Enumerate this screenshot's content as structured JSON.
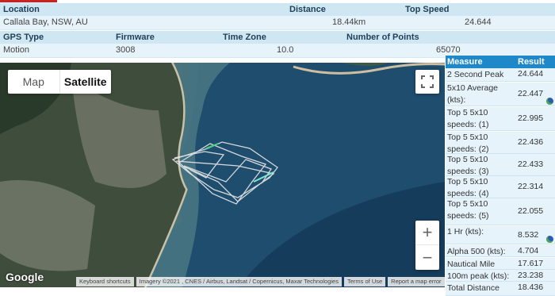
{
  "session": {
    "headers1": {
      "location": "Location",
      "distance": "Distance",
      "top_speed": "Top Speed"
    },
    "values1": {
      "location": "Callala Bay, NSW, AU",
      "distance": "18.44km",
      "top_speed": "24.644"
    },
    "headers2": {
      "gps_type": "GPS Type",
      "firmware": "Firmware",
      "time_zone": "Time Zone",
      "points": "Number of Points"
    },
    "values2": {
      "gps_type": "Motion",
      "firmware": "3008",
      "time_zone": "10.0",
      "points": "65070"
    }
  },
  "map": {
    "map_label": "Map",
    "satellite_label": "Satellite",
    "fullscreen_icon": "fullscreen-icon",
    "zoom_in": "+",
    "zoom_out": "−",
    "logo": "Google",
    "attribution": {
      "shortcuts": "Keyboard shortcuts",
      "imagery": "Imagery ©2021 , CNES / Airbus, Landsat / Copernicus, Maxar Technologies",
      "terms": "Terms of Use",
      "report": "Report a map error"
    },
    "colors": {
      "track": "#e8e8e8",
      "track_fast": "#7de8d0",
      "track_accent": "#3fd07a"
    }
  },
  "results": {
    "header_measure": "Measure",
    "header_result": "Result",
    "rows": [
      {
        "measure": "2 Second Peak (kts):",
        "result": "24.644"
      },
      {
        "measure": "5x10 Average (kts):",
        "result": "22.447",
        "icon": "globe-icon"
      },
      {
        "measure": "Top 5 5x10 speeds: (1)",
        "result": "22.995"
      },
      {
        "measure": "Top 5 5x10 speeds: (2)",
        "result": "22.436"
      },
      {
        "measure": "Top 5 5x10 speeds: (3)",
        "result": "22.433"
      },
      {
        "measure": "Top 5 5x10 speeds: (4)",
        "result": "22.314"
      },
      {
        "measure": "Top 5 5x10 speeds: (5)",
        "result": "22.055"
      },
      {
        "measure": "1 Hr (kts):",
        "result": "8.532",
        "icon": "globe-icon"
      },
      {
        "measure": "Alpha 500 (kts):",
        "result": "4.704"
      },
      {
        "measure": "Nautical Mile (kts):",
        "result": "17.617"
      },
      {
        "measure": "100m peak (kts):",
        "result": "23.238"
      },
      {
        "measure": "Total Distance (km):",
        "result": "18.436"
      }
    ]
  }
}
